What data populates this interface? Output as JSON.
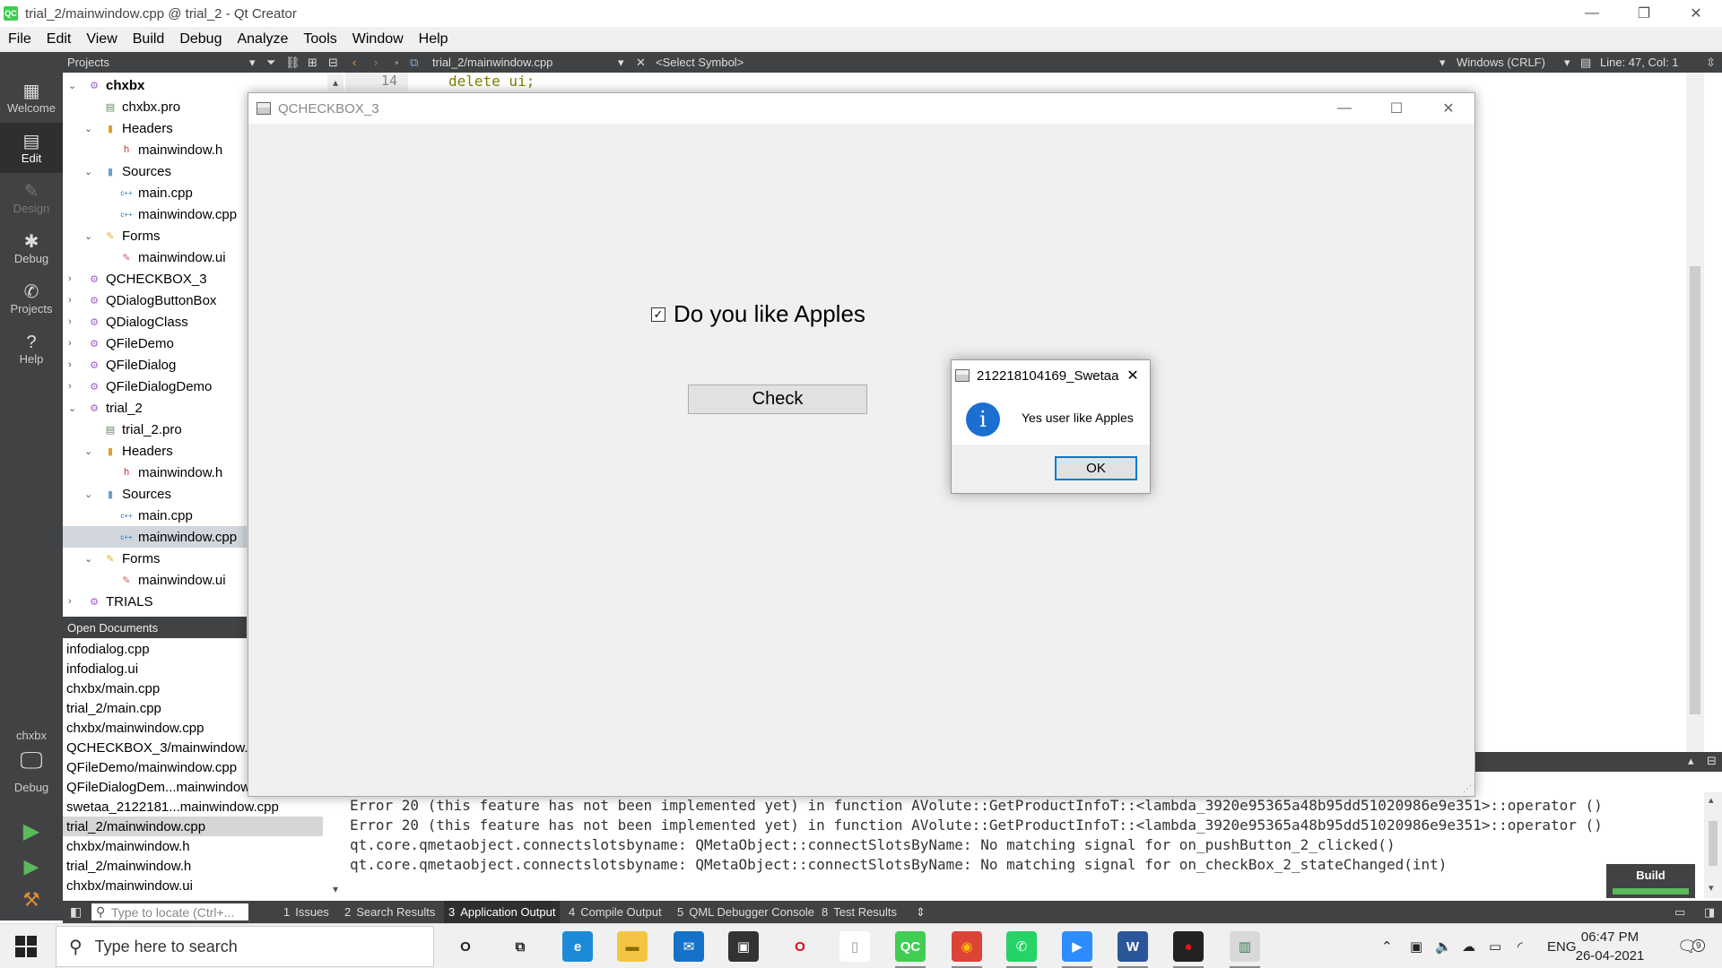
{
  "window": {
    "title": "trial_2/mainwindow.cpp @ trial_2 - Qt Creator",
    "logo": "QC"
  },
  "menu": [
    "File",
    "Edit",
    "View",
    "Build",
    "Debug",
    "Analyze",
    "Tools",
    "Window",
    "Help"
  ],
  "toolbar": {
    "projects_label": "Projects",
    "open_file": "trial_2/mainwindow.cpp",
    "symbol": "<Select Symbol>",
    "line_endings": "Windows (CRLF)",
    "position": "Line: 47, Col: 1"
  },
  "modes": [
    {
      "label": "Welcome",
      "icon": "▦"
    },
    {
      "label": "Edit",
      "icon": "▤"
    },
    {
      "label": "Design",
      "icon": "✎"
    },
    {
      "label": "Debug",
      "icon": "✱"
    },
    {
      "label": "Projects",
      "icon": "✆"
    },
    {
      "label": "Help",
      "icon": "?"
    }
  ],
  "kit": {
    "project": "chxbx",
    "config": "Debug"
  },
  "tree": [
    {
      "label": "chxbx",
      "level": 0,
      "arrow": "v",
      "icon": "proj",
      "bold": true
    },
    {
      "label": "chxbx.pro",
      "level": 1,
      "arrow": "",
      "icon": "pro"
    },
    {
      "label": "Headers",
      "level": 1,
      "arrow": "v",
      "icon": "hdrfolder"
    },
    {
      "label": "mainwindow.h",
      "level": 2,
      "arrow": "",
      "icon": "h"
    },
    {
      "label": "Sources",
      "level": 1,
      "arrow": "v",
      "icon": "srcfolder"
    },
    {
      "label": "main.cpp",
      "level": 2,
      "arrow": "",
      "icon": "cpp"
    },
    {
      "label": "mainwindow.cpp",
      "level": 2,
      "arrow": "",
      "icon": "cpp"
    },
    {
      "label": "Forms",
      "level": 1,
      "arrow": "v",
      "icon": "formfolder"
    },
    {
      "label": "mainwindow.ui",
      "level": 2,
      "arrow": "",
      "icon": "ui"
    },
    {
      "label": "QCHECKBOX_3",
      "level": 0,
      "arrow": ">",
      "icon": "proj"
    },
    {
      "label": "QDialogButtonBox",
      "level": 0,
      "arrow": ">",
      "icon": "proj"
    },
    {
      "label": "QDialogClass",
      "level": 0,
      "arrow": ">",
      "icon": "proj"
    },
    {
      "label": "QFileDemo",
      "level": 0,
      "arrow": ">",
      "icon": "proj"
    },
    {
      "label": "QFileDialog",
      "level": 0,
      "arrow": ">",
      "icon": "proj"
    },
    {
      "label": "QFileDialogDemo",
      "level": 0,
      "arrow": ">",
      "icon": "proj"
    },
    {
      "label": "trial_2",
      "level": 0,
      "arrow": "v",
      "icon": "proj"
    },
    {
      "label": "trial_2.pro",
      "level": 1,
      "arrow": "",
      "icon": "pro"
    },
    {
      "label": "Headers",
      "level": 1,
      "arrow": "v",
      "icon": "hdrfolder"
    },
    {
      "label": "mainwindow.h",
      "level": 2,
      "arrow": "",
      "icon": "h"
    },
    {
      "label": "Sources",
      "level": 1,
      "arrow": "v",
      "icon": "srcfolder"
    },
    {
      "label": "main.cpp",
      "level": 2,
      "arrow": "",
      "icon": "cpp"
    },
    {
      "label": "mainwindow.cpp",
      "level": 2,
      "arrow": "",
      "icon": "cpp",
      "selected": true
    },
    {
      "label": "Forms",
      "level": 1,
      "arrow": "v",
      "icon": "formfolder"
    },
    {
      "label": "mainwindow.ui",
      "level": 2,
      "arrow": "",
      "icon": "ui"
    },
    {
      "label": "TRIALS",
      "level": 0,
      "arrow": ">",
      "icon": "proj"
    }
  ],
  "open_documents": {
    "title": "Open Documents",
    "items": [
      {
        "label": "infodialog.cpp"
      },
      {
        "label": "infodialog.ui"
      },
      {
        "label": "chxbx/main.cpp"
      },
      {
        "label": "trial_2/main.cpp"
      },
      {
        "label": "chxbx/mainwindow.cpp"
      },
      {
        "label": "QCHECKBOX_3/mainwindow.c"
      },
      {
        "label": "QFileDemo/mainwindow.cpp"
      },
      {
        "label": "QFileDialogDem...mainwindow"
      },
      {
        "label": "swetaa_2122181...mainwindow.cpp"
      },
      {
        "label": "trial_2/mainwindow.cpp",
        "selected": true
      },
      {
        "label": "chxbx/mainwindow.h"
      },
      {
        "label": "trial_2/mainwindow.h"
      },
      {
        "label": "chxbx/mainwindow.ui"
      }
    ]
  },
  "editor": {
    "line_number": "14",
    "code": "delete ui;"
  },
  "output": [
    "Error 20 (this feature has not been implemented yet) in function AVolute::GetProductInfoT::<lambda_3920e95365a48b95dd51020986e9e351>::operator ()",
    "Error 20 (this feature has not been implemented yet) in function AVolute::GetProductInfoT::<lambda_3920e95365a48b95dd51020986e9e351>::operator ()",
    "qt.core.qmetaobject.connectslotsbyname: QMetaObject::connectSlotsByName: No matching signal for on_pushButton_2_clicked()",
    "qt.core.qmetaobject.connectslotsbyname: QMetaObject::connectSlotsByName: No matching signal for on_checkBox_2_stateChanged(int)"
  ],
  "build_badge": "Build",
  "statusbar": {
    "locate_placeholder": "Type to locate (Ctrl+...",
    "tabs": [
      {
        "num": "1",
        "label": "Issues"
      },
      {
        "num": "2",
        "label": "Search Results"
      },
      {
        "num": "3",
        "label": "Application Output",
        "active": true
      },
      {
        "num": "4",
        "label": "Compile Output"
      },
      {
        "num": "5",
        "label": "QML Debugger Console"
      },
      {
        "num": "8",
        "label": "Test Results"
      }
    ]
  },
  "app_window": {
    "title": "QCHECKBOX_3",
    "checkbox_label": "Do you like Apples",
    "checkbox_checked": true,
    "button_label": "Check"
  },
  "message_box": {
    "title": "212218104169_Swetaa",
    "text": "Yes user like Apples",
    "ok_label": "OK"
  },
  "taskbar": {
    "search_placeholder": "Type here to search",
    "language": "ENG",
    "time": "06:47 PM",
    "date": "26-04-2021",
    "notifications": "9",
    "apps": [
      {
        "name": "cortana-icon",
        "glyph": "O",
        "color": "#f0f0f0",
        "fg": "#222"
      },
      {
        "name": "task-view-icon",
        "glyph": "⧉",
        "color": "#f0f0f0",
        "fg": "#222"
      },
      {
        "name": "edge-icon",
        "glyph": "e",
        "color": "#1c8ad6",
        "fg": "#fff"
      },
      {
        "name": "file-explorer-icon",
        "glyph": "▬",
        "color": "#f4c542",
        "fg": "#8a6b00"
      },
      {
        "name": "mail-icon",
        "glyph": "✉",
        "color": "#1572c9",
        "fg": "#fff"
      },
      {
        "name": "store-icon",
        "glyph": "▣",
        "color": "#333",
        "fg": "#fff"
      },
      {
        "name": "opera-icon",
        "glyph": "O",
        "color": "#f0f0f0",
        "fg": "#e3001b"
      },
      {
        "name": "notepad-icon",
        "glyph": "▯",
        "color": "#fff",
        "fg": "#999"
      },
      {
        "name": "qt-creator-icon",
        "glyph": "QC",
        "color": "#41cd52",
        "fg": "#fff"
      },
      {
        "name": "chrome-icon",
        "glyph": "◉",
        "color": "#db4437",
        "fg": "#fbbc05"
      },
      {
        "name": "whatsapp-icon",
        "glyph": "✆",
        "color": "#25d366",
        "fg": "#fff"
      },
      {
        "name": "zoom-icon",
        "glyph": "▶",
        "color": "#2d8cff",
        "fg": "#fff"
      },
      {
        "name": "word-icon",
        "glyph": "W",
        "color": "#2b579a",
        "fg": "#fff"
      },
      {
        "name": "recorder-icon",
        "glyph": "●",
        "color": "#222",
        "fg": "#e81123"
      },
      {
        "name": "running-app-icon",
        "glyph": "▥",
        "color": "#d9d9d9",
        "fg": "#3a7d5a"
      }
    ]
  }
}
